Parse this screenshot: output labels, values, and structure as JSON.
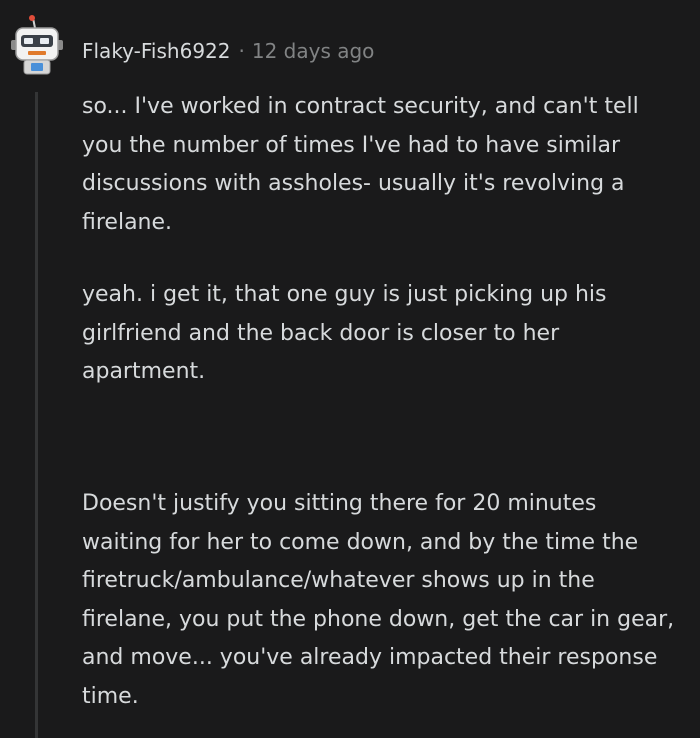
{
  "comment": {
    "username": "Flaky-Fish6922",
    "separator": "·",
    "timestamp": "12 days ago",
    "avatar_icon": "robot-avatar-icon",
    "paragraphs": [
      "so... I've worked in contract security, and can't tell you the number of times I've had to have similar discussions with assholes- usually it's revolving a firelane.",
      "yeah. i get it, that one guy is just picking up his girlfriend and the back door is closer to her apartment.",
      "Doesn't justify you sitting there for 20 minutes waiting for her to come down, and by the time the firetruck/ambulance/whatever shows up in the firelane, you put the phone down, get the car in gear, and move... you've already impacted their response time."
    ]
  },
  "colors": {
    "background": "#1a1a1b",
    "text": "#d7dadc",
    "muted": "#818384",
    "thread_line": "#343536"
  }
}
